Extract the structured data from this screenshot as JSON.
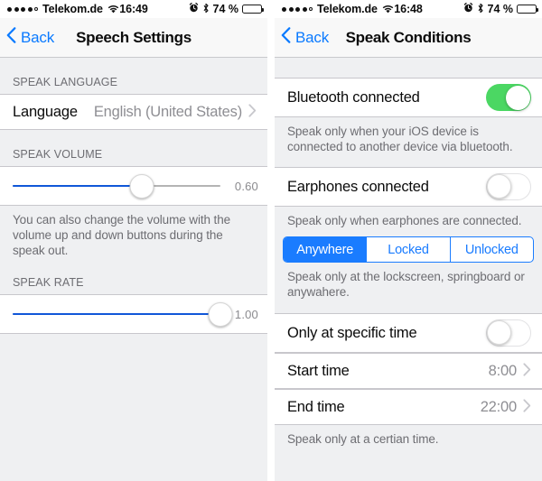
{
  "left": {
    "status": {
      "carrier": "Telekom.de",
      "time": "16:49",
      "battery_percent": "74 %",
      "signal_dots_filled": 4,
      "signal_dots_total": 5,
      "icons": [
        "wifi-icon",
        "alarm-icon",
        "bluetooth-icon",
        "battery-icon"
      ]
    },
    "nav": {
      "back_label": "Back",
      "title": "Speech Settings"
    },
    "sections": {
      "language": {
        "header": "SPEAK LANGUAGE",
        "row_label": "Language",
        "row_value": "English (United States)"
      },
      "volume": {
        "header": "SPEAK VOLUME",
        "value": "0.60",
        "fill_percent": 62,
        "footnote": "You can also change the volume with the volume up and down buttons during the speak out."
      },
      "rate": {
        "header": "SPEAK RATE",
        "value": "1.00",
        "fill_percent": 100
      }
    }
  },
  "right": {
    "status": {
      "carrier": "Telekom.de",
      "time": "16:48",
      "battery_percent": "74 %",
      "signal_dots_filled": 4,
      "signal_dots_total": 5,
      "icons": [
        "wifi-icon",
        "alarm-icon",
        "bluetooth-icon",
        "battery-icon"
      ]
    },
    "nav": {
      "back_label": "Back",
      "title": "Speak Conditions"
    },
    "bluetooth": {
      "label": "Bluetooth connected",
      "state": "on",
      "footnote": "Speak only when your iOS device is connected to another device via bluetooth."
    },
    "earphones": {
      "label": "Earphones connected",
      "state": "off",
      "footnote": "Speak only when earphones are connected."
    },
    "segmented": {
      "options": [
        "Anywhere",
        "Locked",
        "Unlocked"
      ],
      "selected_index": 0,
      "footnote": "Speak only at the lockscreen, springboard or anywahere."
    },
    "time_section": {
      "toggle_label": "Only at specific time",
      "toggle_state": "off",
      "start_label": "Start time",
      "start_value": "8:00",
      "end_label": "End time",
      "end_value": "22:00",
      "footnote": "Speak only at a certian time."
    }
  },
  "colors": {
    "accent_blue": "#0a7aff",
    "segment_blue": "#1a7cff",
    "switch_green": "#4bd763",
    "slider_blue": "#1057d8",
    "group_bg": "#eff0f2"
  }
}
